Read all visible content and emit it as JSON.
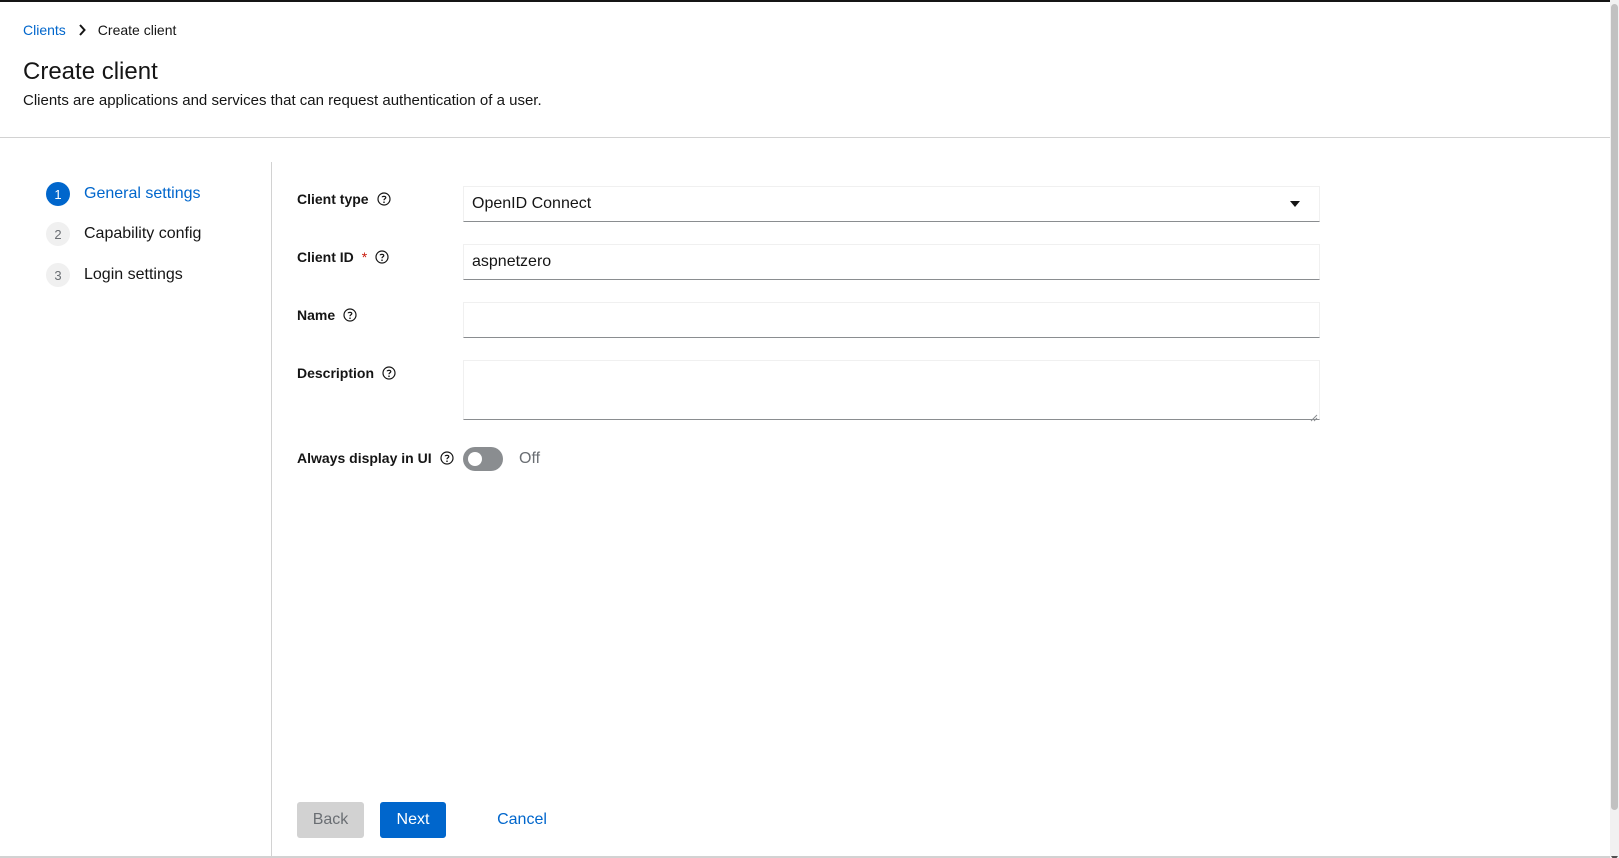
{
  "breadcrumb": {
    "parent": "Clients",
    "current": "Create client"
  },
  "header": {
    "title": "Create client",
    "subtitle": "Clients are applications and services that can request authentication of a user."
  },
  "wizard": {
    "steps": [
      {
        "number": "1",
        "label": "General settings",
        "active": true
      },
      {
        "number": "2",
        "label": "Capability config",
        "active": false
      },
      {
        "number": "3",
        "label": "Login settings",
        "active": false
      }
    ]
  },
  "form": {
    "client_type": {
      "label": "Client type",
      "value": "OpenID Connect"
    },
    "client_id": {
      "label": "Client ID",
      "required_mark": "*",
      "value": "aspnetzero"
    },
    "name": {
      "label": "Name",
      "value": ""
    },
    "description": {
      "label": "Description",
      "value": ""
    },
    "always_display": {
      "label": "Always display in UI",
      "state": "Off",
      "checked": false
    }
  },
  "footer": {
    "back_label": "Back",
    "next_label": "Next",
    "cancel_label": "Cancel"
  },
  "colors": {
    "accent": "#0066cc",
    "required": "#c9190b",
    "disabled": "#d2d2d2"
  },
  "icons": {
    "breadcrumb_separator": "chevron-right-icon",
    "help": "help-circle-icon",
    "select_caret": "caret-down-icon"
  }
}
